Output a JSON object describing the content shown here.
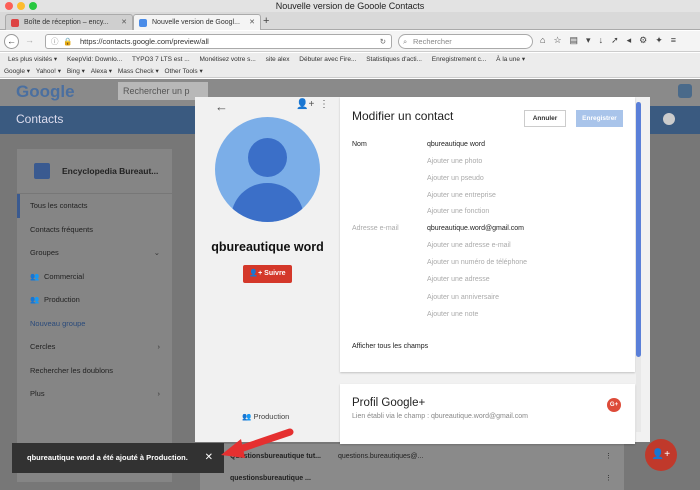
{
  "window": {
    "title": "Nouvelle version de Gooole Contacts"
  },
  "tabs": [
    {
      "label": "Boîte de réception – ency...",
      "active": false
    },
    {
      "label": "Nouvelle version de Googl...",
      "active": true
    }
  ],
  "nav": {
    "url": "https://contacts.google.com/preview/all",
    "search_placeholder": "Rechercher"
  },
  "bookmarks": [
    "Les plus visités ▾",
    "KeepVid: Downlo...",
    "TYPO3 7 LTS est ...",
    "Monétisez votre s...",
    "site alex",
    "Débuter avec Fire...",
    "Statistiques d'acti...",
    "Enregistrement c...",
    "À la une ▾"
  ],
  "bookmarks2": [
    "Google ▾",
    "Yahoo! ▾",
    "Bing ▾",
    "Alexa ▾",
    "Mass Check ▾",
    "Other Tools ▾"
  ],
  "app": {
    "logo": "Google",
    "search_placeholder": "Rechercher un p",
    "section_title": "Contacts"
  },
  "sidebar": {
    "account_name": "Encyclopedia Bureaut...",
    "items": [
      {
        "label": "Tous les contacts",
        "selected": true
      },
      {
        "label": "Contacts fréquents"
      },
      {
        "label": "Groupes",
        "chevron": "⌄"
      },
      {
        "label": "Commercial",
        "indent": true
      },
      {
        "label": "Production",
        "indent": true
      },
      {
        "label": "Nouveau groupe",
        "blue": true
      },
      {
        "label": "Cercles",
        "chevron": "›"
      },
      {
        "label": "Rechercher les doublons"
      },
      {
        "label": "Plus",
        "chevron": "›"
      }
    ]
  },
  "list_rows": [
    {
      "name": "Questionsbureautique tut...",
      "email": "questions.bureautiques@..."
    },
    {
      "name": "questionsbureautique ...",
      "email": ""
    }
  ],
  "contact": {
    "name": "qbureautique word",
    "follow_label": "Suivre",
    "group_tag": "Production"
  },
  "edit": {
    "title": "Modifier un contact",
    "cancel_label": "Annuler",
    "save_label": "Enregistrer",
    "name_label": "Nom",
    "name_value": "qbureautique word",
    "add_photo": "Ajouter une photo",
    "add_nickname": "Ajouter un pseudo",
    "add_company": "Ajouter une entreprise",
    "add_job": "Ajouter une fonction",
    "email_label": "Adresse e-mail",
    "email_value": "qbureautique.word@gmail.com",
    "add_email": "Ajouter une adresse e-mail",
    "add_phone": "Ajouter un numéro de téléphone",
    "add_address": "Ajouter une adresse",
    "add_birthday": "Ajouter un anniversaire",
    "add_note": "Ajouter une note",
    "show_all": "Afficher tous les champs"
  },
  "profile": {
    "title": "Profil Google+",
    "subtitle": "Lien établi via le champ : qbureautique.word@gmail.com",
    "badge": "G+"
  },
  "toast": {
    "message": "qbureautique word a été ajouté à Production.",
    "close": "✕"
  },
  "colors": {
    "accent": "#3b6fc8",
    "follow": "#d4382a",
    "save": "#a9c4ea",
    "arrow": "#e53030"
  }
}
